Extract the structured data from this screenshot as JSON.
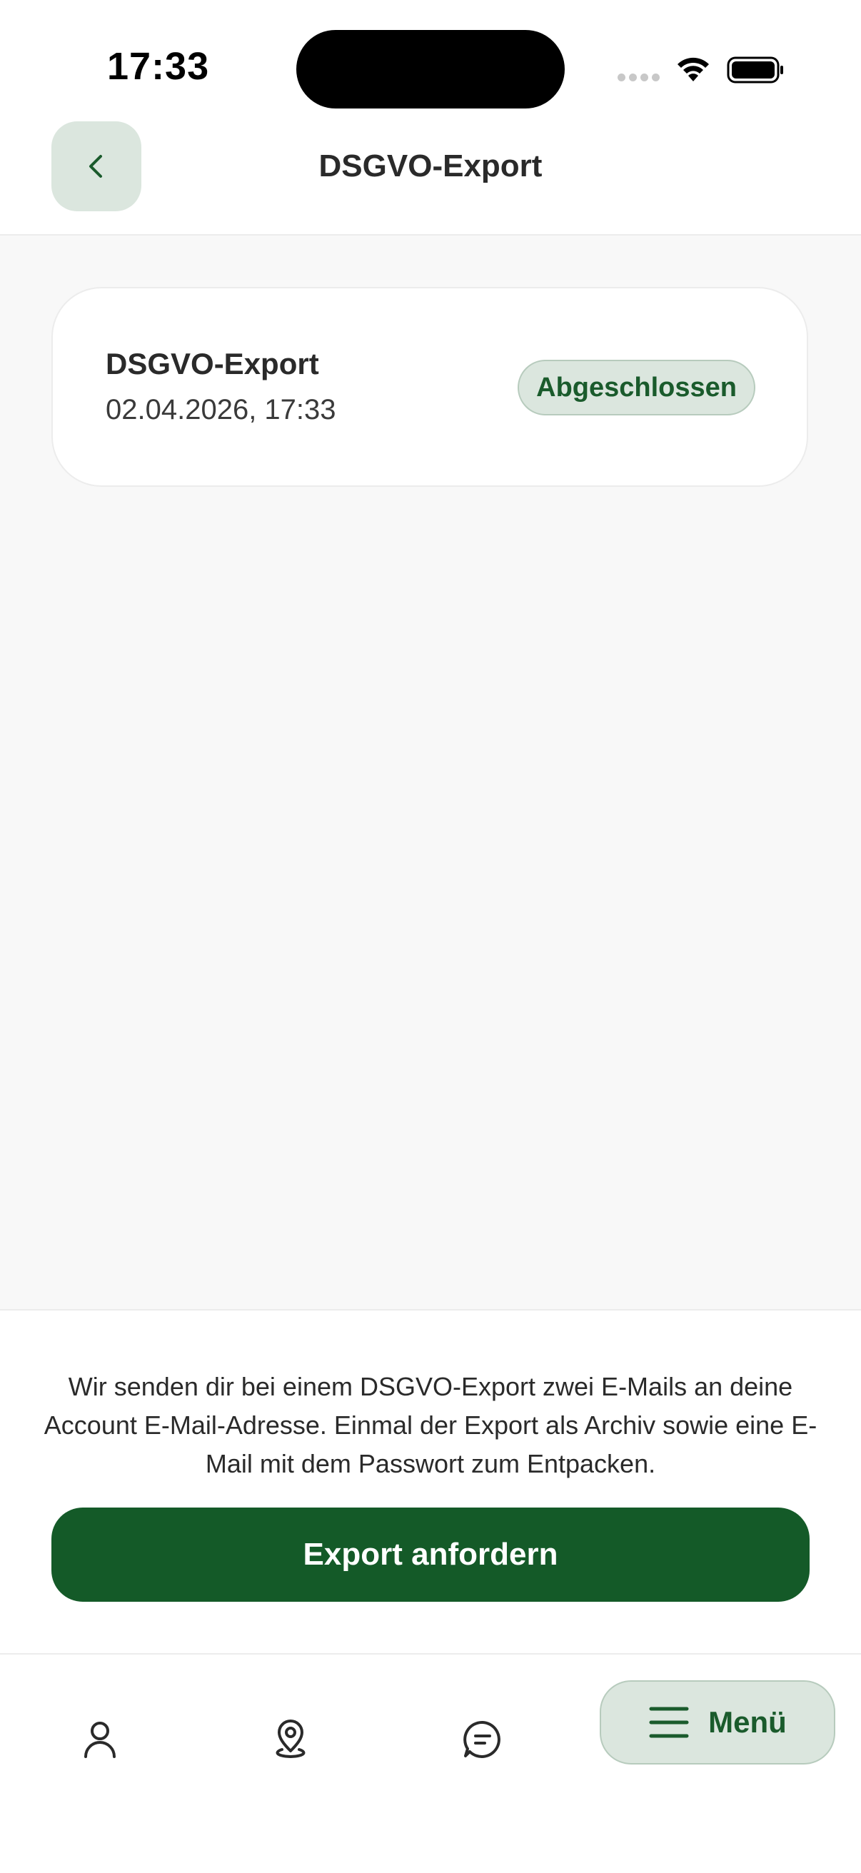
{
  "status_bar": {
    "time": "17:33"
  },
  "header": {
    "title": "DSGVO-Export",
    "back_icon": "chevron-left-icon"
  },
  "export_list": [
    {
      "title": "DSGVO-Export",
      "date": "02.04.2026, 17:33",
      "status": "Abgeschlossen"
    }
  ],
  "footer": {
    "info_text": "Wir senden dir bei einem DSGVO-Export zwei E-Mails an deine Account E-Mail-Adresse. Einmal der Export als Archiv sowie eine E-Mail mit dem Passwort zum Entpacken.",
    "export_button_label": "Export anfordern"
  },
  "bottom_nav": {
    "items": [
      {
        "icon": "user-icon"
      },
      {
        "icon": "map-pin-icon"
      },
      {
        "icon": "chat-icon"
      }
    ],
    "menu_label": "Menü",
    "menu_icon": "hamburger-icon"
  },
  "colors": {
    "primary": "#145a28",
    "primary_light": "#dbe6de",
    "badge_border": "#b7cbbd",
    "background": "#f8f8f8",
    "text": "#2a2a2a"
  }
}
